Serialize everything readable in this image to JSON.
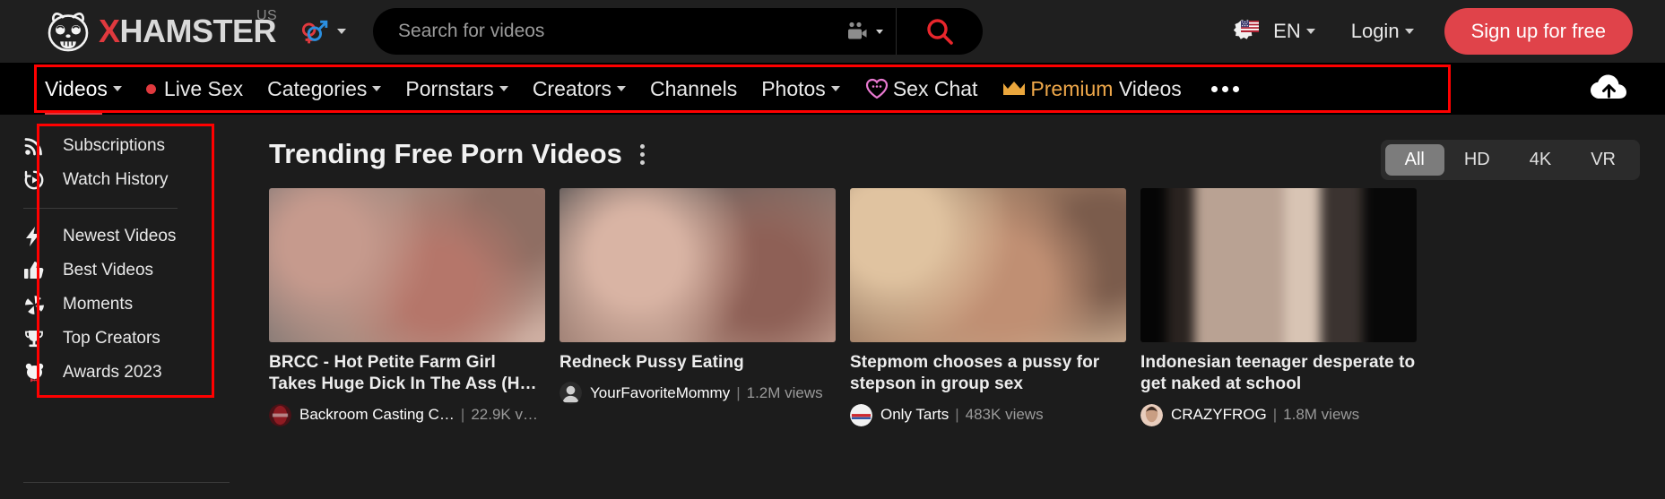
{
  "brand": {
    "name_x": "X",
    "name_rest": "HAMSTER",
    "region": "US",
    "logo_icon": "hamster-logo-icon",
    "gender_icon": "gender-symbols-icon"
  },
  "search": {
    "placeholder": "Search for videos",
    "value": "",
    "camera_icon": "video-camera-icon",
    "submit_icon": "search-icon"
  },
  "header": {
    "lang_flag_icon": "us-flag-gear-icon",
    "lang_label": "EN",
    "login_label": "Login",
    "signup_label": "Sign up for free",
    "accent_color": "#e0434a"
  },
  "nav": {
    "items": [
      {
        "label": "Videos",
        "icon": null,
        "caret": true,
        "active": true
      },
      {
        "label": "Live Sex",
        "icon": "live-dot-icon",
        "caret": false,
        "active": false
      },
      {
        "label": "Categories",
        "icon": null,
        "caret": true,
        "active": false
      },
      {
        "label": "Pornstars",
        "icon": null,
        "caret": true,
        "active": false
      },
      {
        "label": "Creators",
        "icon": null,
        "caret": true,
        "active": false
      },
      {
        "label": "Channels",
        "icon": null,
        "caret": false,
        "active": false
      },
      {
        "label": "Photos",
        "icon": null,
        "caret": true,
        "active": false
      },
      {
        "label": "Sex Chat",
        "icon": "heart-chat-icon",
        "caret": false,
        "active": false
      },
      {
        "label": "Premium Videos",
        "icon": "crown-icon",
        "caret": false,
        "active": false,
        "gold_word": "Premium"
      }
    ],
    "more_icon": "more-dots-icon",
    "upload_icon": "cloud-upload-icon",
    "highlight_color": "#ff0000"
  },
  "sidebar": {
    "groups": [
      {
        "items": [
          {
            "label": "Subscriptions",
            "icon": "rss-icon"
          },
          {
            "label": "Watch History",
            "icon": "watch-history-icon"
          }
        ]
      },
      {
        "items": [
          {
            "label": "Newest Videos",
            "icon": "lightning-bolt-icon"
          },
          {
            "label": "Best Videos",
            "icon": "thumbs-up-icon"
          },
          {
            "label": "Moments",
            "icon": "aperture-icon"
          },
          {
            "label": "Top Creators",
            "icon": "trophy-icon"
          },
          {
            "label": "Awards 2023",
            "icon": "hamster-bowtie-icon"
          }
        ]
      }
    ]
  },
  "main": {
    "title": "Trending Free Porn Videos",
    "kebab_icon": "more-options-icon",
    "filters": [
      {
        "label": "All",
        "active": true
      },
      {
        "label": "HD",
        "active": false
      },
      {
        "label": "4K",
        "active": false
      },
      {
        "label": "VR",
        "active": false
      }
    ],
    "videos": [
      {
        "title": "BRCC - Hot Petite Farm Girl Takes Huge Dick In The Ass (H…",
        "uploader": "Backroom Casting C…",
        "views": "22.9K v…",
        "avatar_icon": "channel-avatar-icon",
        "thumb_class": "blur-a"
      },
      {
        "title": "Redneck Pussy Eating",
        "uploader": "YourFavoriteMommy",
        "views": "1.2M views",
        "avatar_icon": "channel-avatar-icon",
        "thumb_class": "blur-b"
      },
      {
        "title": "Stepmom chooses a pussy for stepson in group sex",
        "uploader": "Only Tarts",
        "views": "483K views",
        "avatar_icon": "channel-avatar-icon",
        "thumb_class": "blur-c"
      },
      {
        "title": "Indonesian teenager desperate to get naked at school",
        "uploader": "CRAZYFROG",
        "views": "1.8M views",
        "avatar_icon": "channel-avatar-icon",
        "thumb_class": "blur-d"
      }
    ]
  }
}
